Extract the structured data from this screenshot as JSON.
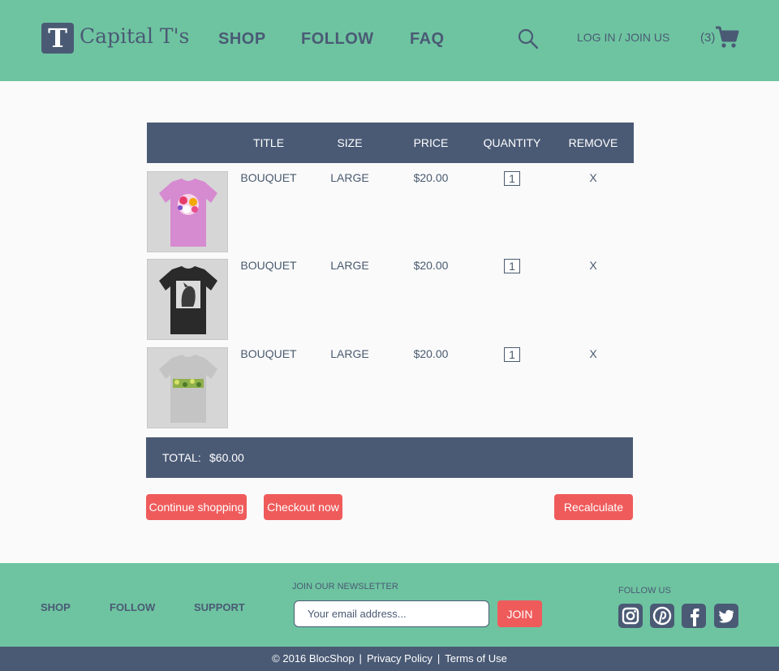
{
  "brand": {
    "logo_letter": "T",
    "name": "Capital T's"
  },
  "nav": {
    "shop": "SHOP",
    "follow": "FOLLOW",
    "faq": "FAQ"
  },
  "header": {
    "login": "LOG IN / JOIN US",
    "cart_count": "(3)"
  },
  "table": {
    "columns": [
      "TITLE",
      "SIZE",
      "PRICE",
      "QUANTITY",
      "REMOVE"
    ],
    "rows": [
      {
        "title": "BOUQUET",
        "size": "LARGE",
        "price": "$20.00",
        "quantity": "1",
        "remove": "X",
        "shirt_color": "#d68ad0",
        "image": "pink-floral-tshirt"
      },
      {
        "title": "BOUQUET",
        "size": "LARGE",
        "price": "$20.00",
        "quantity": "1",
        "remove": "X",
        "shirt_color": "#2a2a2a",
        "image": "black-dog-tshirt"
      },
      {
        "title": "BOUQUET",
        "size": "LARGE",
        "price": "$20.00",
        "quantity": "1",
        "remove": "X",
        "shirt_color": "#c4c4c4",
        "image": "grey-camo-tshirt"
      }
    ]
  },
  "total": {
    "label": "TOTAL:",
    "value": "$60.00"
  },
  "actions": {
    "continue": "Continue shopping",
    "checkout": "Checkout now",
    "recalculate": "Recalculate"
  },
  "footer": {
    "links": [
      "SHOP",
      "FOLLOW",
      "SUPPORT"
    ],
    "newsletter_label": "JOIN OUR NEWSLETTER",
    "email_placeholder": "Your email address...",
    "join": "JOIN",
    "follow_label": "FOLLOW US",
    "social_icons": [
      "instagram-icon",
      "pinterest-icon",
      "facebook-icon",
      "twitter-icon"
    ]
  },
  "bottom": {
    "copyright": "© 2016 BlocShop",
    "privacy": "Privacy Policy",
    "terms": "Terms of Use"
  },
  "colors": {
    "header_bg": "#6ec4a0",
    "navy": "#4a5a75",
    "accent": "#ef5b5b",
    "page_bg": "#fafafa"
  }
}
